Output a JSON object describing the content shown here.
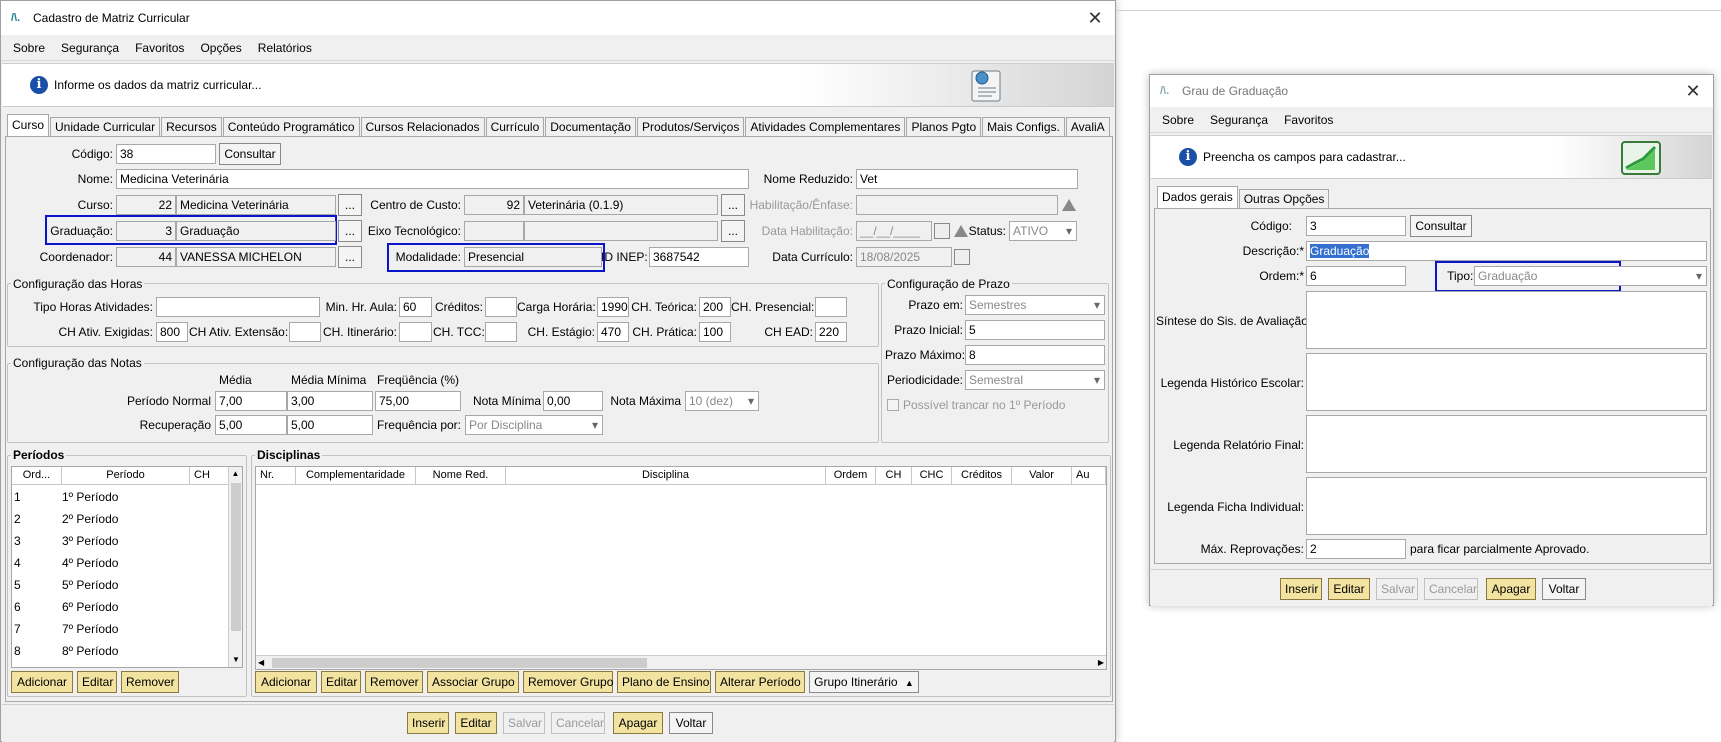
{
  "w1": {
    "title": "Cadastro de Matriz Curricular",
    "menu": [
      "Sobre",
      "Segurança",
      "Favoritos",
      "Opções",
      "Relatórios"
    ],
    "info": "Informe os dados da matriz curricular...",
    "tabs": [
      "Curso",
      "Unidade Curricular",
      "Recursos",
      "Conteúdo Programático",
      "Cursos Relacionados",
      "Currículo",
      "Documentação",
      "Produtos/Serviços",
      "Atividades Complementares",
      "Planos Pgto",
      "Mais Configs.",
      "AvaliA"
    ],
    "codigo_lbl": "Código:",
    "codigo": "38",
    "consultar": "Consultar",
    "nome_lbl": "Nome:",
    "nome": "Medicina Veterinária",
    "nome_red_lbl": "Nome Reduzido:",
    "nome_red": "Vet",
    "curso_lbl": "Curso:",
    "curso_id": "22",
    "curso": "Medicina Veterinária",
    "cc_lbl": "Centro de Custo:",
    "cc_id": "92",
    "cc": "Veterinária (0.1.9)",
    "hab_lbl": "Habilitação/Ênfase:",
    "grad_lbl": "Graduação:",
    "grad_id": "3",
    "grad": "Graduação",
    "eixo_lbl": "Eixo Tecnológico:",
    "datahab_lbl": "Data Habilitação:",
    "datahab": "__/__/____",
    "status_lbl": "Status:",
    "status": "ATIVO",
    "coord_lbl": "Coordenador:",
    "coord_id": "44",
    "coord": "VANESSA MICHELON",
    "mod_lbl": "Modalidade:",
    "mod": "Presencial",
    "inep_lbl": "ID INEP:",
    "inep": "3687542",
    "datacur_lbl": "Data Currículo:",
    "datacur": "18/08/2025",
    "dots": "...",
    "horas": {
      "title": "Configuração das Horas",
      "tipo_lbl": "Tipo Horas Atividades:",
      "minhr_lbl": "Min. Hr. Aula:",
      "minhr": "60",
      "cred_lbl": "Créditos:",
      "ch_lbl": "Carga Horária:",
      "ch": "1990",
      "teo_lbl": "CH. Teórica:",
      "teo": "200",
      "pres_lbl": "CH. Presencial:",
      "exig_lbl": "CH Ativ. Exigidas:",
      "exig": "800",
      "ext_lbl": "CH Ativ. Extensão:",
      "itin_lbl": "CH. Itinerário:",
      "tcc_lbl": "CH. TCC:",
      "est_lbl": "CH. Estágio:",
      "est": "470",
      "prat_lbl": "CH. Prática:",
      "prat": "100",
      "ead_lbl": "CH EAD:",
      "ead": "220"
    },
    "prazo": {
      "title": "Configuração de Prazo",
      "em_lbl": "Prazo em:",
      "em": "Semestres",
      "ini_lbl": "Prazo Inicial:",
      "ini": "5",
      "max_lbl": "Prazo Máximo:",
      "max": "8",
      "per_lbl": "Periodicidade:",
      "per": "Semestral",
      "trancar": "Possível trancar no 1º Período"
    },
    "notas": {
      "title": "Configuração das Notas",
      "media_h": "Média",
      "mediamin_h": "Média Mínima",
      "freq_h": "Freqüência (%)",
      "pn_lbl": "Período Normal",
      "pn_media": "7,00",
      "pn_min": "3,00",
      "pn_freq": "75,00",
      "nmin_lbl": "Nota Mínima",
      "nmin": "0,00",
      "nmax_lbl": "Nota Máxima",
      "nmax": "10 (dez)",
      "rec_lbl": "Recuperação",
      "rec_media": "5,00",
      "rec_min": "5,00",
      "freqpor_lbl": "Frequência por:",
      "freqpor": "Por Disciplina"
    },
    "periodos": {
      "title": "Períodos",
      "cols": [
        "Ord...",
        "Período",
        "CH"
      ],
      "rows": [
        [
          "1",
          "1º Período"
        ],
        [
          "2",
          "2º Período"
        ],
        [
          "3",
          "3º Período"
        ],
        [
          "4",
          "4º Período"
        ],
        [
          "5",
          "5º Período"
        ],
        [
          "6",
          "6º Período"
        ],
        [
          "7",
          "7º Período"
        ],
        [
          "8",
          "8º Período"
        ]
      ],
      "btns": [
        "Adicionar",
        "Editar",
        "Remover"
      ]
    },
    "disc": {
      "title": "Disciplinas",
      "cols": [
        "Nr.",
        "Complementaridade",
        "Nome Red.",
        "Disciplina",
        "Ordem",
        "CH",
        "CHC",
        "Créditos",
        "Valor",
        "Au"
      ],
      "btns": [
        "Adicionar",
        "Editar",
        "Remover",
        "Associar Grupo",
        "Remover Grupo",
        "Plano de Ensino",
        "Alterar Período"
      ],
      "grupo": "Grupo Itinerário"
    },
    "footer": [
      "Inserir",
      "Editar",
      "Salvar",
      "Cancelar",
      "Apagar",
      "Voltar"
    ]
  },
  "w2": {
    "title": "Grau de Graduação",
    "menu": [
      "Sobre",
      "Segurança",
      "Favoritos"
    ],
    "info": "Preencha os campos para cadastrar...",
    "tabs": [
      "Dados gerais",
      "Outras Opções"
    ],
    "codigo_lbl": "Código:",
    "codigo": "3",
    "consultar": "Consultar",
    "desc_lbl": "Descrição:*",
    "desc": "Graduação",
    "ordem_lbl": "Ordem:*",
    "ordem": "6",
    "tipo_lbl": "Tipo:*",
    "tipo": "Graduação",
    "sintese_lbl": "Síntese do Sis. de Avaliação:",
    "leg_hist_lbl": "Legenda Histórico Escolar:",
    "leg_rel_lbl": "Legenda Relatório Final:",
    "leg_ficha_lbl": "Legenda Ficha Individual:",
    "maxrep_lbl": "Máx. Reprovações:",
    "maxrep": "2",
    "maxrep_suffix": "para ficar parcialmente Aprovado.",
    "footer": [
      "Inserir",
      "Editar",
      "Salvar",
      "Cancelar",
      "Apagar",
      "Voltar"
    ]
  },
  "colors": {
    "highlight": "#0a14c8",
    "yellow_btn": "#f2e3a0",
    "info_icon": "#1a4fa8"
  }
}
